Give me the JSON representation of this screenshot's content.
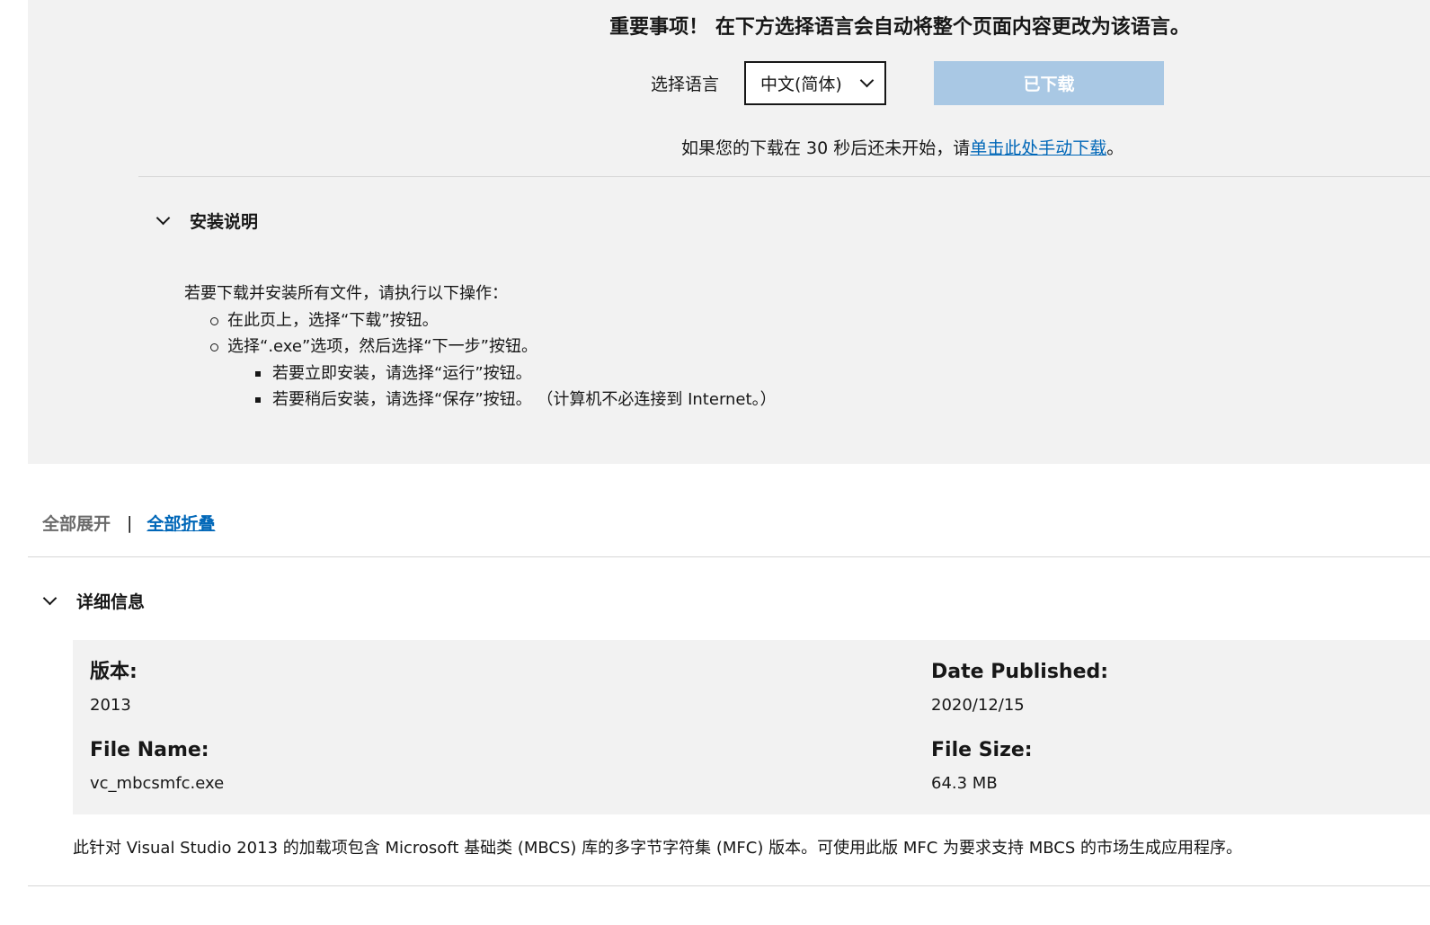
{
  "banner": {
    "important_text": "重要事项！ 在下方选择语言会自动将整个页面内容更改为该语言。",
    "language_label": "选择语言",
    "language_selected": "中文(简体)",
    "download_button": "已下载",
    "manual_prefix": "如果您的下载在 30 秒后还未开始，请",
    "manual_link": "单击此处手动下载",
    "manual_suffix": "。"
  },
  "install": {
    "header": "安装说明",
    "intro": "若要下载并安装所有文件，请执行以下操作：",
    "steps": [
      "在此页上，选择“下载”按钮。",
      "选择“.exe”选项，然后选择“下一步”按钮。"
    ],
    "substeps": [
      "若要立即安装，请选择“运行”按钮。",
      "若要稍后安装，请选择“保存”按钮。 （计算机不必连接到 Internet。）"
    ]
  },
  "toggle": {
    "expand_all": "全部展开",
    "separator": "|",
    "collapse_all": "全部折叠"
  },
  "details": {
    "header": "详细信息",
    "version_label": "版本:",
    "version_value": "2013",
    "date_label": "Date Published:",
    "date_value": "2020/12/15",
    "filename_label": "File Name:",
    "filename_value": "vc_mbcsmfc.exe",
    "filesize_label": "File Size:",
    "filesize_value": "64.3 MB",
    "description": "此针对 Visual Studio 2013 的加载项包含 Microsoft 基础类 (MBCS) 库的多字节字符集 (MFC) 版本。可使用此版 MFC 为要求支持 MBCS 的市场生成应用程序。"
  },
  "colors": {
    "link": "#0067b8",
    "disabled_button": "#a9c8e4",
    "panel_bg": "#f2f2f2"
  }
}
